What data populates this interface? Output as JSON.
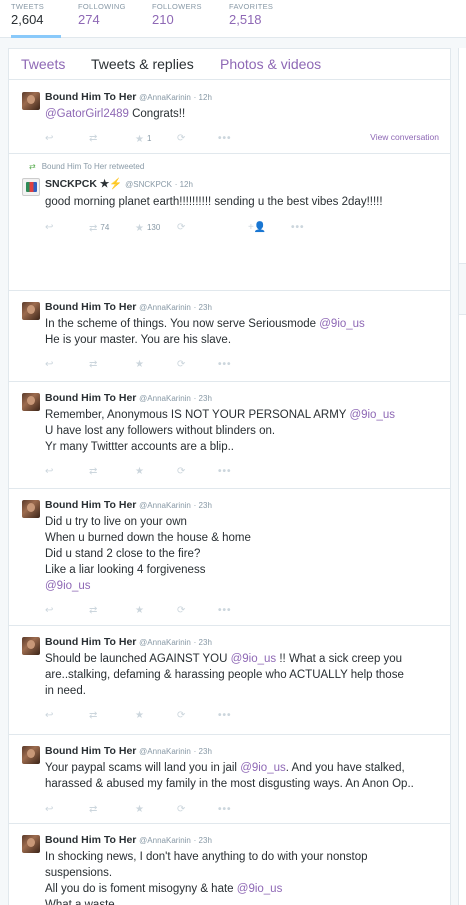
{
  "stats": [
    {
      "label": "TWEETS",
      "value": "2,604"
    },
    {
      "label": "FOLLOWING",
      "value": "274"
    },
    {
      "label": "FOLLOWERS",
      "value": "210"
    },
    {
      "label": "FAVORITES",
      "value": "2,518"
    }
  ],
  "tabs": [
    "Tweets",
    "Tweets & replies",
    "Photos & videos"
  ],
  "tweets": [
    {
      "name": "Bound Him To Her",
      "handle": "@AnnaKarinin",
      "time": "· 12h",
      "lines": [
        {
          "mention": "@GatorGirl2489",
          "text": " Congrats!!"
        }
      ],
      "fav_count": "1",
      "view_conversation": "View conversation"
    },
    {
      "retweeted_by": "Bound Him To Her retweeted",
      "name": "SNCKPCK ★⚡",
      "handle": "@SNCKPCK",
      "time": "· 12h",
      "lines": [
        {
          "text": "good morning planet earth!!!!!!!!!! sending u the best vibes 2day!!!!!"
        }
      ],
      "rt_count": "74",
      "fav_count": "130"
    },
    {
      "name": "Bound Him To Her",
      "handle": "@AnnaKarinin",
      "time": "· 23h",
      "lines": [
        {
          "text": "In the scheme of things. You now serve Seriousmode ",
          "mention": "@9io_us"
        },
        {
          "text": "He is your master. You are his slave."
        }
      ]
    },
    {
      "name": "Bound Him To Her",
      "handle": "@AnnaKarinin",
      "time": "· 23h",
      "lines": [
        {
          "text": "Remember, Anonymous IS NOT YOUR PERSONAL ARMY ",
          "mention": "@9io_us"
        },
        {
          "text": "U have lost any followers without blinders on."
        },
        {
          "text": "Yr many Twittter accounts are a blip.."
        }
      ]
    },
    {
      "name": "Bound Him To Her",
      "handle": "@AnnaKarinin",
      "time": "· 23h",
      "lines": [
        {
          "text": "Did u try to live on your own"
        },
        {
          "text": "When u burned down the house & home"
        },
        {
          "text": "Did u stand 2 close to the fire?"
        },
        {
          "text": "Like a liar looking 4 forgiveness"
        },
        {
          "mention": "@9io_us"
        }
      ]
    },
    {
      "name": "Bound Him To Her",
      "handle": "@AnnaKarinin",
      "time": "· 23h",
      "lines": [
        {
          "text": "Should be launched AGAINST YOU ",
          "mention": "@9io_us",
          "after": " !! What a sick creep you"
        },
        {
          "text": "are..stalking, defaming & harassing people who ACTUALLY help those"
        },
        {
          "text": "in need."
        }
      ]
    },
    {
      "name": "Bound Him To Her",
      "handle": "@AnnaKarinin",
      "time": "· 23h",
      "lines": [
        {
          "text": "Your paypal scams will land you in jail ",
          "mention": "@9io_us",
          "after": ". And you have stalked,"
        },
        {
          "text": "harassed & abused my family in the most disgusting ways. An Anon Op.."
        }
      ]
    },
    {
      "name": "Bound Him To Her",
      "handle": "@AnnaKarinin",
      "time": "· 23h",
      "lines": [
        {
          "text": "In shocking news, I don't have anything to do with your nonstop"
        },
        {
          "text": "suspensions."
        },
        {
          "text": "All you do is foment misogyny & hate ",
          "mention": "@9io_us"
        },
        {
          "text": "What a waste."
        }
      ]
    }
  ]
}
